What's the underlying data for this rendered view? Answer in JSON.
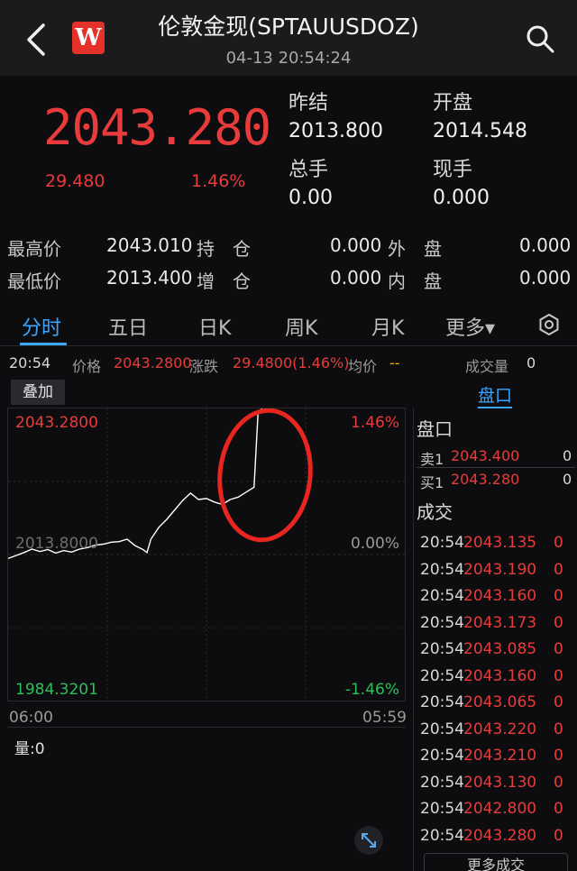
{
  "header": {
    "title": "伦敦金现(SPTAUUSDOZ)",
    "datetime": "04-13 20:54:24",
    "logo_letter": "W"
  },
  "quote": {
    "price": "2043.280",
    "change": "29.480",
    "change_pct": "1.46%",
    "prev_settle_label": "昨结",
    "prev_settle": "2013.800",
    "open_label": "开盘",
    "open": "2014.548",
    "total_volume_label": "总手",
    "total_volume": "0.00",
    "current_volume_label": "现手",
    "current_volume": "0.000"
  },
  "stats": {
    "high_label": "最高价",
    "high": "2043.010",
    "hold_label": "持　仓",
    "hold": "0.000",
    "outer_label": "外　盘",
    "outer": "0.000",
    "low_label": "最低价",
    "low": "2013.400",
    "add_label": "增　仓",
    "add": "0.000",
    "inner_label": "内　盘",
    "inner": "0.000"
  },
  "tabs": [
    {
      "label": "分时"
    },
    {
      "label": "五日"
    },
    {
      "label": "日K"
    },
    {
      "label": "周K"
    },
    {
      "label": "月K"
    },
    {
      "label": "更多▾"
    }
  ],
  "infobar": {
    "time": "20:54",
    "price_label": "价格",
    "price": "2043.2800",
    "chg_label": "涨跌",
    "chg": "29.4800(1.46%)",
    "avg_label": "均价",
    "avg": "--",
    "vol_label": "成交量",
    "vol": "0"
  },
  "overlay_label": "叠加",
  "pankou_tab": "盘口",
  "chart_labels": {
    "top_left": "2043.2800",
    "top_right": "1.46%",
    "mid_left": "2013.8000",
    "mid_right": "0.00%",
    "bottom_left": "1984.3201",
    "bottom_right": "-1.46%",
    "x_start": "06:00",
    "x_end": "05:59",
    "volume_label": "量:0"
  },
  "chart_data": {
    "type": "line",
    "ylim": [
      1984.3201,
      2043.28
    ],
    "reference": 2013.8,
    "session_progress": [
      0.0,
      0.02,
      0.04,
      0.06,
      0.08,
      0.1,
      0.12,
      0.14,
      0.16,
      0.18,
      0.2,
      0.22,
      0.24,
      0.26,
      0.28,
      0.3,
      0.32,
      0.34,
      0.35,
      0.36,
      0.38,
      0.4,
      0.42,
      0.44,
      0.46,
      0.48,
      0.5,
      0.52,
      0.54,
      0.56,
      0.58,
      0.6,
      0.62,
      0.63,
      0.64
    ],
    "values": [
      2013.0,
      2013.6,
      2014.2,
      2014.9,
      2014.4,
      2014.8,
      2014.1,
      2014.6,
      2014.3,
      2014.9,
      2015.2,
      2015.7,
      2015.9,
      2016.3,
      2016.4,
      2016.9,
      2015.6,
      2014.8,
      2014.2,
      2016.9,
      2019.3,
      2020.9,
      2022.8,
      2024.7,
      2026.2,
      2024.9,
      2025.1,
      2024.4,
      2023.9,
      2024.9,
      2025.4,
      2026.4,
      2027.4,
      2042.3,
      2043.28
    ],
    "line_color": "#ffffff",
    "annotation_color": "#e8261f"
  },
  "orderbook": {
    "title": "盘口",
    "ask_label": "卖1",
    "ask_price": "2043.400",
    "ask_qty": "0",
    "bid_label": "买1",
    "bid_price": "2043.280",
    "bid_qty": "0"
  },
  "trades": {
    "title": "成交",
    "rows": [
      {
        "time": "20:54",
        "price": "2043.135",
        "qty": "0"
      },
      {
        "time": "20:54",
        "price": "2043.190",
        "qty": "0"
      },
      {
        "time": "20:54",
        "price": "2043.160",
        "qty": "0"
      },
      {
        "time": "20:54",
        "price": "2043.173",
        "qty": "0"
      },
      {
        "time": "20:54",
        "price": "2043.085",
        "qty": "0"
      },
      {
        "time": "20:54",
        "price": "2043.160",
        "qty": "0"
      },
      {
        "time": "20:54",
        "price": "2043.065",
        "qty": "0"
      },
      {
        "time": "20:54",
        "price": "2043.220",
        "qty": "0"
      },
      {
        "time": "20:54",
        "price": "2043.210",
        "qty": "0"
      },
      {
        "time": "20:54",
        "price": "2043.130",
        "qty": "0"
      },
      {
        "time": "20:54",
        "price": "2042.800",
        "qty": "0"
      },
      {
        "time": "20:54",
        "price": "2043.280",
        "qty": "0"
      }
    ],
    "more_label": "更多成交"
  }
}
